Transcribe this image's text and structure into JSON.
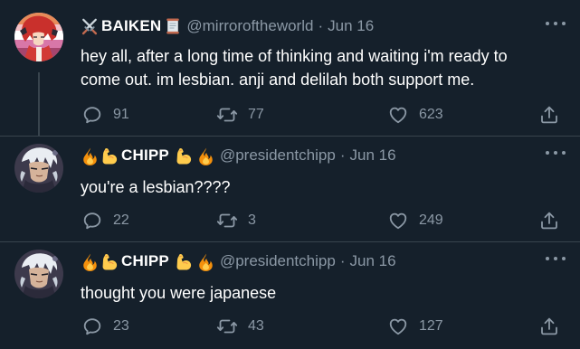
{
  "tweets": [
    {
      "display_name": "BAIKEN",
      "name_prefix_icons": [
        "crossed-swords-icon"
      ],
      "name_suffix_icons": [
        "scroll-icon"
      ],
      "handle": "@mirroroftheworld",
      "separator": "·",
      "date": "Jun 16",
      "text": "hey all, after a long time of thinking and waiting i'm ready to come out. im lesbian. anji and delilah both support me.",
      "replies": "91",
      "retweets": "77",
      "likes": "623"
    },
    {
      "display_name": "CHIPP",
      "name_prefix_icons": [
        "fire-icon",
        "flexed-biceps-icon"
      ],
      "name_suffix_icons": [
        "flexed-biceps-icon",
        "fire-icon"
      ],
      "handle": "@presidentchipp",
      "separator": "·",
      "date": "Jun 16",
      "text": "you're a lesbian????",
      "replies": "22",
      "retweets": "3",
      "likes": "249"
    },
    {
      "display_name": "CHIPP",
      "name_prefix_icons": [
        "fire-icon",
        "flexed-biceps-icon"
      ],
      "name_suffix_icons": [
        "flexed-biceps-icon",
        "fire-icon"
      ],
      "handle": "@presidentchipp",
      "separator": "·",
      "date": "Jun 16",
      "text": "thought you were japanese",
      "replies": "23",
      "retweets": "43",
      "likes": "127"
    }
  ],
  "colors": {
    "background": "#15202b",
    "text_primary": "#ffffff",
    "text_secondary": "#8b98a5",
    "divider": "#38444d"
  }
}
